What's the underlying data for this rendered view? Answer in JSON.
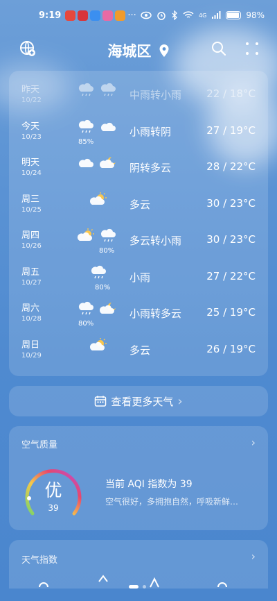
{
  "status": {
    "time": "9:19",
    "network": "4G",
    "battery": "98%",
    "more": "···"
  },
  "header": {
    "location": "海城区"
  },
  "forecast": [
    {
      "day": "昨天",
      "date": "10/22",
      "desc": "中雨转小雨",
      "temp": "22 / 18°C",
      "icons": [
        "heavy-rain-cloud-icon",
        "rain-cloud-icon"
      ],
      "pct": "",
      "past": true
    },
    {
      "day": "今天",
      "date": "10/23",
      "desc": "小雨转阴",
      "temp": "27 / 19°C",
      "icons": [
        "rain-cloud-icon",
        "cloud-icon"
      ],
      "pct": "85%"
    },
    {
      "day": "明天",
      "date": "10/24",
      "desc": "阴转多云",
      "temp": "28 / 22°C",
      "icons": [
        "cloud-icon",
        "moon-cloud-icon"
      ],
      "pct": ""
    },
    {
      "day": "周三",
      "date": "10/25",
      "desc": "多云",
      "temp": "30 / 23°C",
      "icons": [
        "sun-cloud-icon"
      ],
      "pct": ""
    },
    {
      "day": "周四",
      "date": "10/26",
      "desc": "多云转小雨",
      "temp": "30 / 23°C",
      "icons": [
        "sun-cloud-icon",
        "rain-cloud-icon"
      ],
      "pct": "80%"
    },
    {
      "day": "周五",
      "date": "10/27",
      "desc": "小雨",
      "temp": "27 / 22°C",
      "icons": [
        "rain-cloud-icon"
      ],
      "pct": "80%"
    },
    {
      "day": "周六",
      "date": "10/28",
      "desc": "小雨转多云",
      "temp": "25 / 19°C",
      "icons": [
        "rain-cloud-icon",
        "moon-cloud-icon"
      ],
      "pct": "80%"
    },
    {
      "day": "周日",
      "date": "10/29",
      "desc": "多云",
      "temp": "26 / 19°C",
      "icons": [
        "sun-cloud-icon"
      ],
      "pct": ""
    }
  ],
  "more_weather": {
    "label": "查看更多天气",
    "chevron": "›"
  },
  "aqi": {
    "title": "空气质量",
    "level": "优",
    "value": "39",
    "summary": "当前 AQI 指数为 39",
    "advice": "空气很好，多拥抱自然，呼吸新鲜…",
    "chevron": "›"
  },
  "weather_index": {
    "title": "天气指数",
    "chevron": "›"
  },
  "colors": {
    "gauge_start": "#7bd36a",
    "gauge_mid": "#f5c84a",
    "gauge_end": "#b44fe0",
    "gauge_hot": "#e8476b"
  }
}
